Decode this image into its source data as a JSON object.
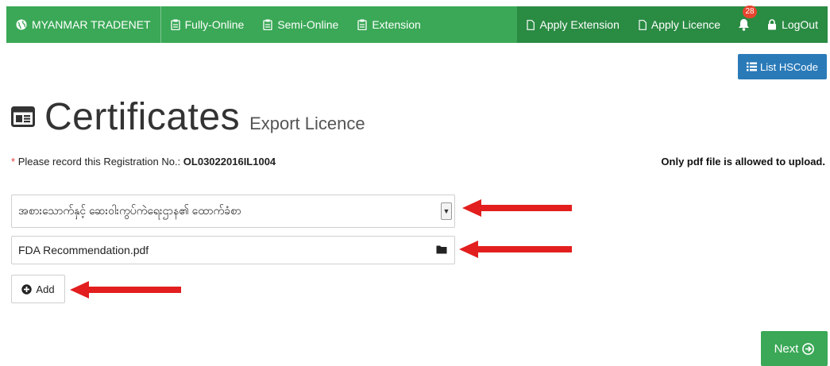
{
  "nav": {
    "brand": "MYANMAR TRADENET",
    "fully_online": "Fully-Online",
    "semi_online": "Semi-Online",
    "extension": "Extension",
    "apply_extension": "Apply Extension",
    "apply_licence": "Apply Licence",
    "notification_count": "28",
    "logout": "LogOut"
  },
  "list_hscode_label": "List HSCode",
  "page": {
    "title": "Certificates",
    "subtitle": "Export Licence"
  },
  "registration": {
    "required_mark": "*",
    "prefix": "Please record this Registration No.:",
    "number": "OL03022016IL1004"
  },
  "upload_note": "Only pdf file is allowed to upload.",
  "certificate_select": {
    "selected_value": "အစားသောက်နှင့် ဆေးဝါးကွပ်ကဲရေးဌာန၏ ထောက်ခံစာ"
  },
  "file_input": {
    "value": "FDA Recommendation.pdf"
  },
  "add_label": "Add",
  "next_label": "Next",
  "colors": {
    "nav_green": "#3aa856",
    "nav_dark_green": "#2a8b43",
    "button_blue": "#2a7ab8",
    "arrow_red": "#e21e1e",
    "badge_red": "#e8452f"
  },
  "icons": {
    "brand": "globe-icon",
    "menu": "clipboard-icon",
    "apply": "document-icon",
    "notifications": "bell-icon",
    "logout": "lock-icon",
    "list": "list-icon",
    "title": "certificate-card-icon",
    "file": "folder-icon",
    "add": "plus-circle-icon",
    "next": "arrow-circle-right-icon"
  }
}
